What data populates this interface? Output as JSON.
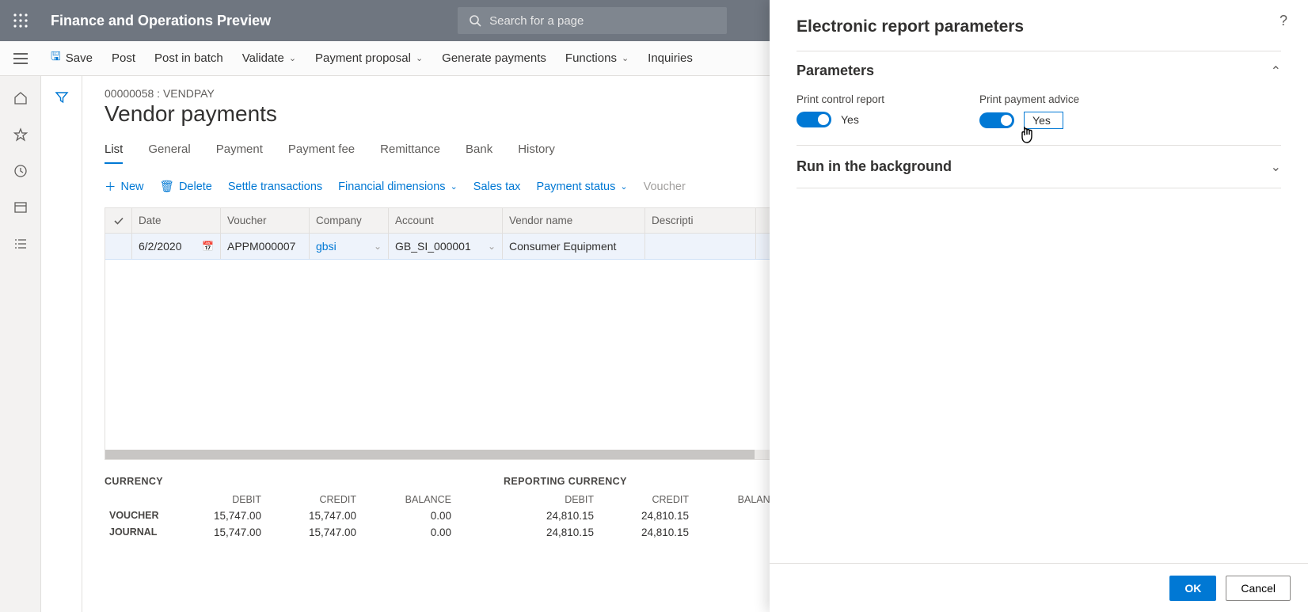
{
  "app": {
    "title": "Finance and Operations Preview",
    "search_placeholder": "Search for a page"
  },
  "commands": {
    "save": "Save",
    "post": "Post",
    "post_in_batch": "Post in batch",
    "validate": "Validate",
    "payment_proposal": "Payment proposal",
    "generate_payments": "Generate payments",
    "functions": "Functions",
    "inquiries": "Inquiries"
  },
  "page": {
    "crumb": "00000058 : VENDPAY",
    "title": "Vendor payments"
  },
  "tabs": {
    "list": "List",
    "general": "General",
    "payment": "Payment",
    "payment_fee": "Payment fee",
    "remittance": "Remittance",
    "bank": "Bank",
    "history": "History"
  },
  "actions": {
    "new": "New",
    "delete": "Delete",
    "settle": "Settle transactions",
    "fin_dim": "Financial dimensions",
    "sales_tax": "Sales tax",
    "payment_status": "Payment status",
    "voucher": "Voucher"
  },
  "grid": {
    "headers": {
      "date": "Date",
      "voucher": "Voucher",
      "company": "Company",
      "account": "Account",
      "vendor_name": "Vendor name",
      "description": "Descripti"
    },
    "row": {
      "date": "6/2/2020",
      "voucher": "APPM000007",
      "company": "gbsi",
      "account": "GB_SI_000001",
      "vendor_name": "Consumer Equipment"
    }
  },
  "summary": {
    "currency_title": "CURRENCY",
    "reporting_title": "REPORTING CURRENCY",
    "cols": {
      "debit": "DEBIT",
      "credit": "CREDIT",
      "balance": "BALANCE"
    },
    "rows": {
      "voucher": "VOUCHER",
      "journal": "JOURNAL"
    },
    "currency": {
      "voucher": {
        "debit": "15,747.00",
        "credit": "15,747.00",
        "balance": "0.00"
      },
      "journal": {
        "debit": "15,747.00",
        "credit": "15,747.00",
        "balance": "0.00"
      }
    },
    "reporting": {
      "voucher": {
        "debit": "24,810.15",
        "credit": "24,810.15"
      },
      "journal": {
        "debit": "24,810.15",
        "credit": "24,810.15"
      }
    }
  },
  "panel": {
    "title": "Electronic report parameters",
    "parameters_title": "Parameters",
    "print_control_label": "Print control report",
    "print_control_value": "Yes",
    "print_advice_label": "Print payment advice",
    "print_advice_value": "Yes",
    "run_bg_title": "Run in the background",
    "ok": "OK",
    "cancel": "Cancel"
  }
}
